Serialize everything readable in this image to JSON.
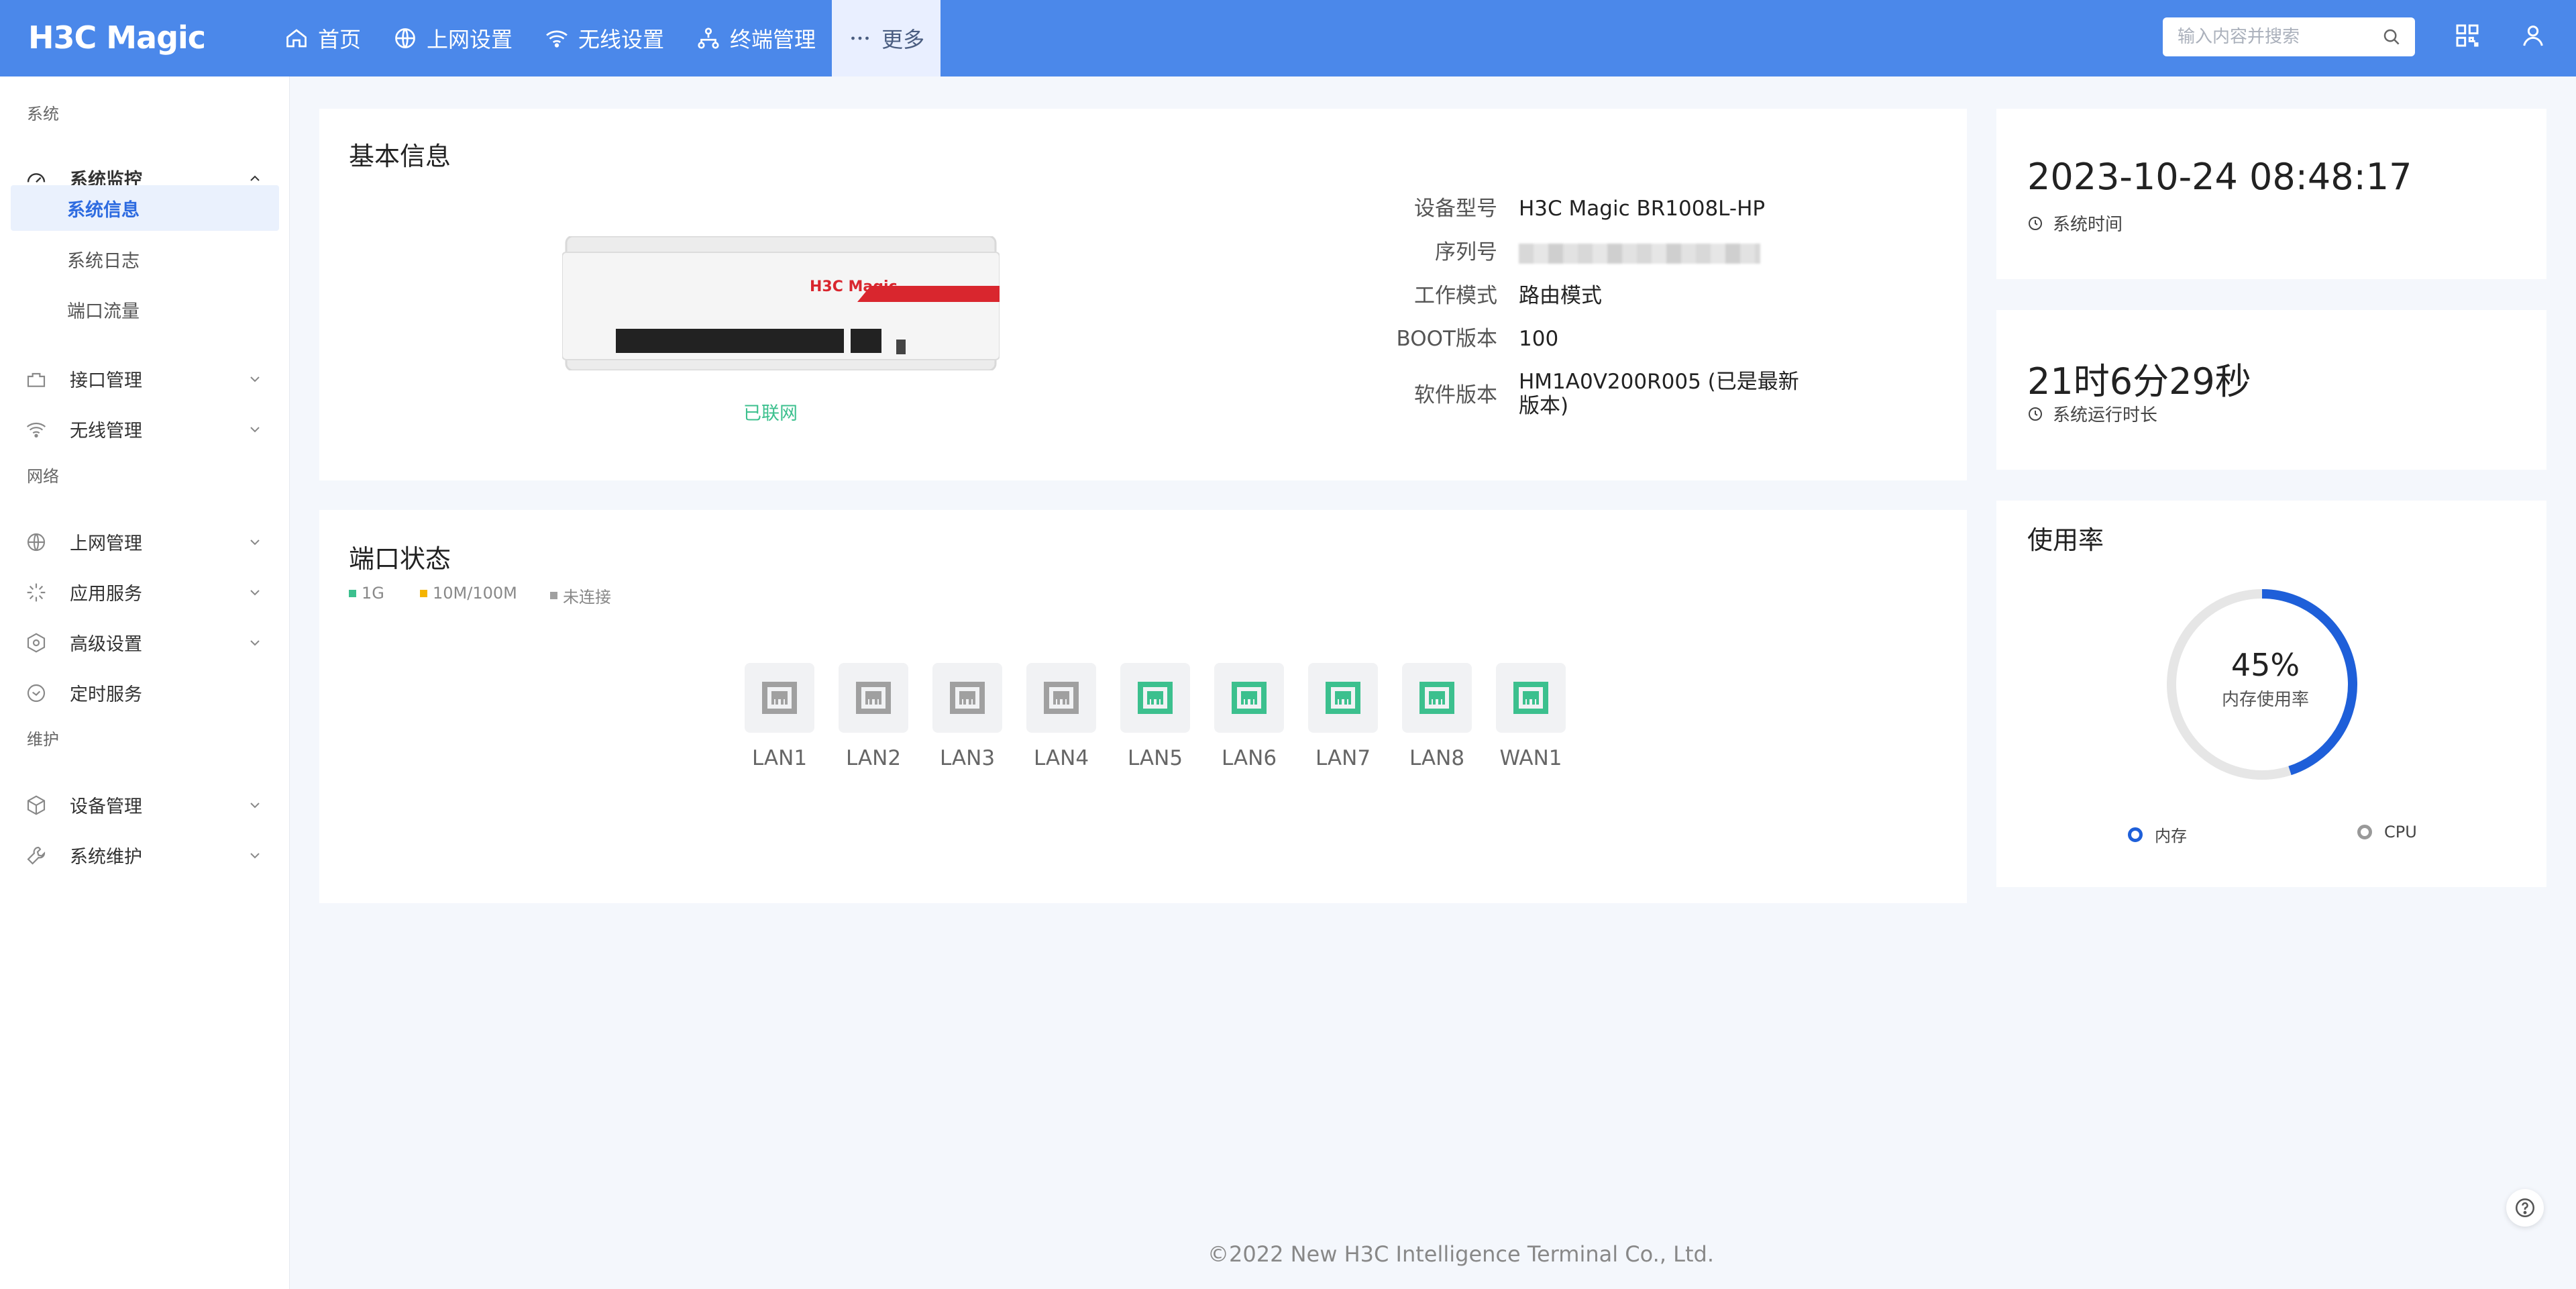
{
  "brand": {
    "logo_text": "H3C Magic"
  },
  "topnav": [
    {
      "label": "首页",
      "icon": "home-icon"
    },
    {
      "label": "上网设置",
      "icon": "globe-icon"
    },
    {
      "label": "无线设置",
      "icon": "wifi-icon"
    },
    {
      "label": "终端管理",
      "icon": "network-tree-icon"
    },
    {
      "label": "更多",
      "icon": "more-icon"
    }
  ],
  "search": {
    "placeholder": "输入内容并搜索"
  },
  "sidebar": {
    "sections": [
      "系统",
      "网络",
      "维护"
    ],
    "items": [
      {
        "label": "系统监控",
        "icon": "gauge-icon",
        "expanded": true
      },
      {
        "label": "接口管理",
        "icon": "port-icon"
      },
      {
        "label": "无线管理",
        "icon": "wifi-icon"
      },
      {
        "label": "上网管理",
        "icon": "globe-icon"
      },
      {
        "label": "应用服务",
        "icon": "apps-icon"
      },
      {
        "label": "高级设置",
        "icon": "hexagon-gear-icon"
      },
      {
        "label": "定时服务",
        "icon": "clock-icon"
      },
      {
        "label": "设备管理",
        "icon": "cube-icon"
      },
      {
        "label": "系统维护",
        "icon": "wrench-icon"
      }
    ],
    "sub_items": [
      "系统信息",
      "系统日志",
      "端口流量"
    ],
    "active_sub": "系统信息"
  },
  "basic_info": {
    "title": "基本信息",
    "device_status": "已联网",
    "device_brand_label": "H3C Magic",
    "rows": [
      {
        "key": "设备型号",
        "value": "H3C Magic BR1008L-HP"
      },
      {
        "key": "序列号",
        "value": ""
      },
      {
        "key": "工作模式",
        "value": "路由模式"
      },
      {
        "key": "BOOT版本",
        "value": "100"
      },
      {
        "key": "软件版本",
        "value_line1": "HM1A0V200R005 (已是最新",
        "value_line2": "版本)"
      }
    ]
  },
  "port_status": {
    "title": "端口状态",
    "legend": [
      {
        "label": "1G",
        "color": "#3cc08e"
      },
      {
        "label": "10M/100M",
        "color": "#f5b400"
      },
      {
        "label": "未连接",
        "color": "#a0a0a0"
      }
    ],
    "ports": [
      {
        "name": "LAN1",
        "state": "未连接"
      },
      {
        "name": "LAN2",
        "state": "未连接"
      },
      {
        "name": "LAN3",
        "state": "未连接"
      },
      {
        "name": "LAN4",
        "state": "未连接"
      },
      {
        "name": "LAN5",
        "state": "1G"
      },
      {
        "name": "LAN6",
        "state": "1G"
      },
      {
        "name": "LAN7",
        "state": "1G"
      },
      {
        "name": "LAN8",
        "state": "1G"
      },
      {
        "name": "WAN1",
        "state": "1G"
      }
    ]
  },
  "system_time": {
    "value": "2023-10-24 08:48:17",
    "label": "系统时间"
  },
  "uptime": {
    "value": "21时6分29秒",
    "label": "系统运行时长"
  },
  "usage": {
    "title": "使用率",
    "percent_text": "45%",
    "percent_value": 45,
    "center_label": "内存使用率",
    "legend": [
      {
        "label": "内存",
        "color": "#1e5fd9",
        "selected": true
      },
      {
        "label": "CPU",
        "color": "#999999",
        "selected": false
      }
    ]
  },
  "footer": {
    "copyright": "©2022 New H3C Intelligence Terminal Co., Ltd."
  },
  "colors": {
    "topbar": "#4b88ea",
    "accent": "#2d6be0",
    "port_1g": "#3cc08e",
    "port_off": "#a0a0a0"
  }
}
